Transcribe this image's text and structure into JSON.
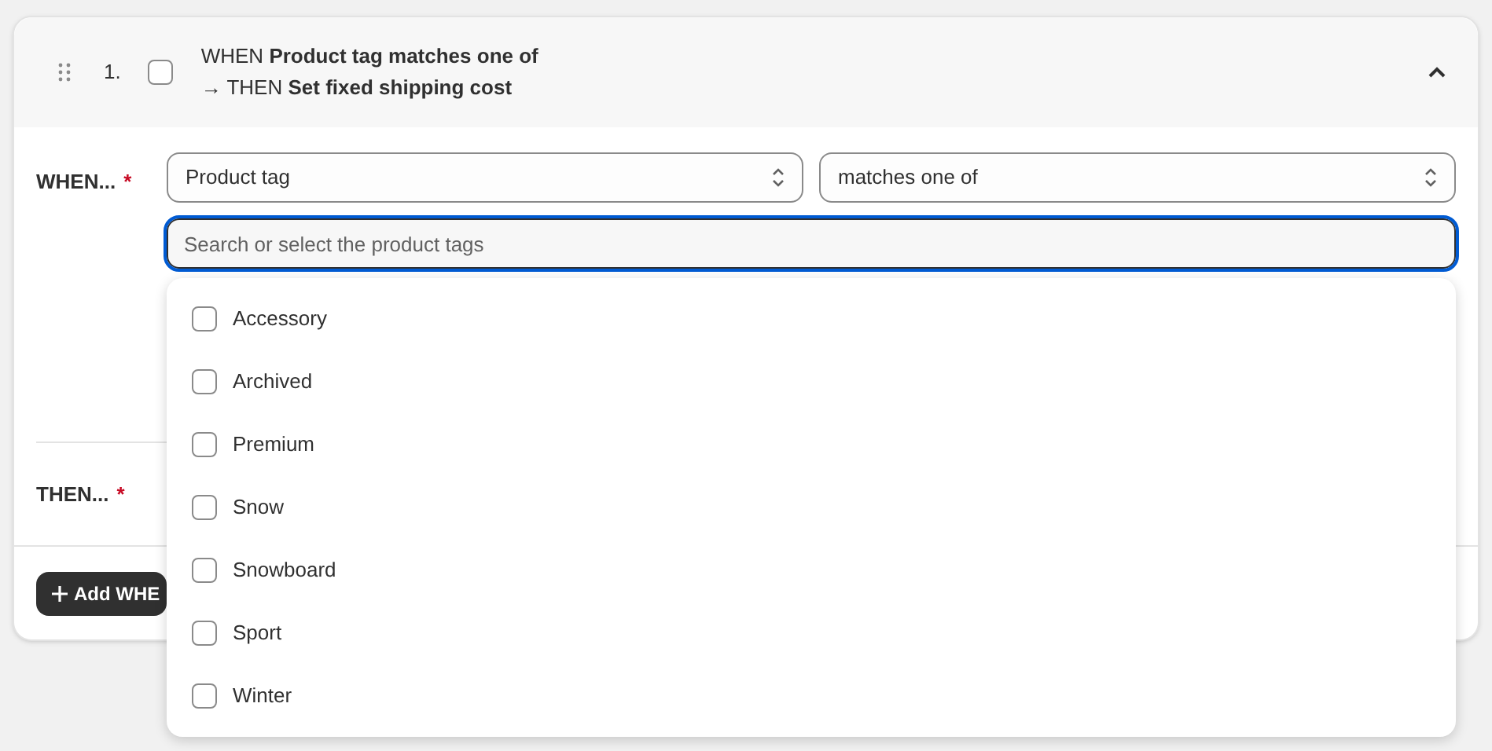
{
  "rule": {
    "number": "1.",
    "checked": false,
    "expanded": true,
    "summary_when": "WHEN **Product tag matches one of**",
    "summary_then": "→ THEN **Set fixed shipping cost**"
  },
  "when": {
    "label": "WHEN...",
    "required_mark": "*",
    "field": "Product tag",
    "operator": "matches one of",
    "search": {
      "placeholder": "Search or select the product tags"
    }
  },
  "tags": [
    {
      "label": "Accessory",
      "checked": false
    },
    {
      "label": "Archived",
      "checked": false
    },
    {
      "label": "Premium",
      "checked": false
    },
    {
      "label": "Snow",
      "checked": false
    },
    {
      "label": "Snowboard",
      "checked": false
    },
    {
      "label": "Sport",
      "checked": false
    },
    {
      "label": "Winter",
      "checked": false
    }
  ],
  "then": {
    "label": "THEN...",
    "required_mark": "*"
  },
  "add_button": {
    "label": "Add WHE"
  }
}
